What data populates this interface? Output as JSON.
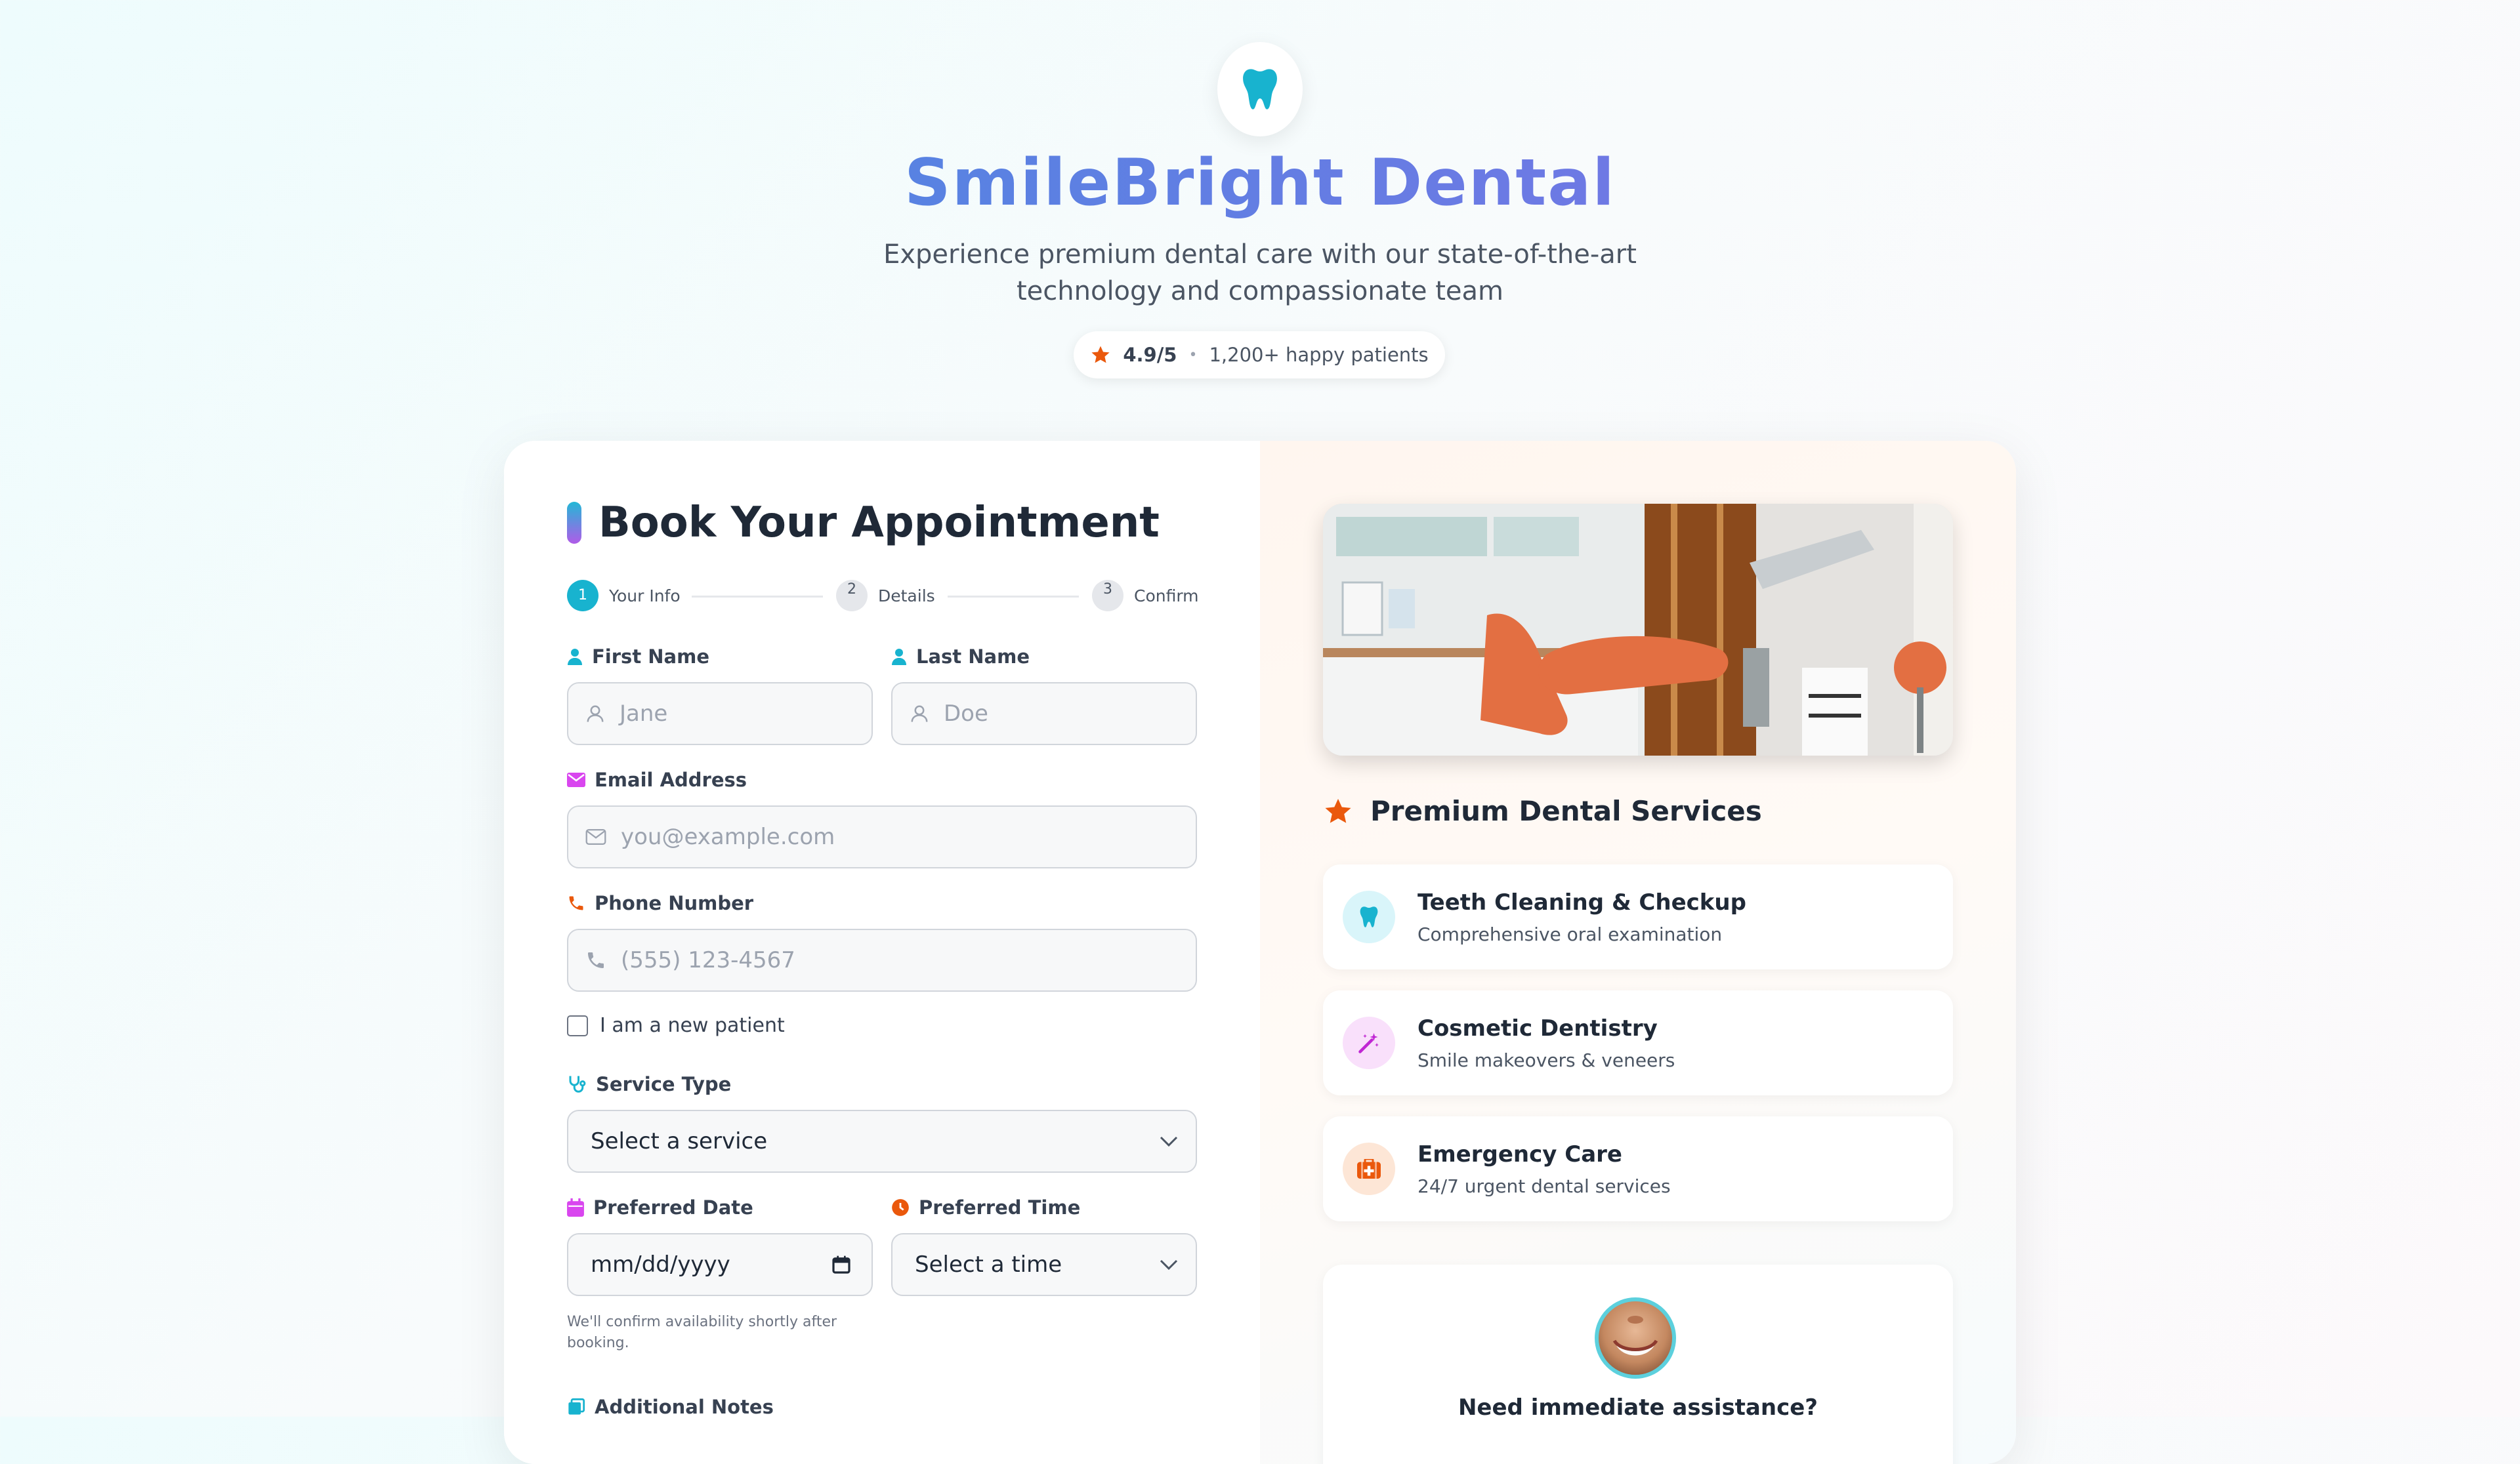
{
  "brand": {
    "name": "SmileBright Dental",
    "tagline": "Experience premium dental care with our state-of-the-art technology and compassionate team",
    "rating": "4.9/5",
    "rating_sep": "•",
    "patients": "1,200+ happy patients",
    "logo_icon": "tooth-icon",
    "accent": "#18b3cf"
  },
  "form": {
    "title": "Book Your Appointment",
    "steps": [
      {
        "num": "1",
        "label": "Your Info"
      },
      {
        "num": "2",
        "label": "Details"
      },
      {
        "num": "3",
        "label": "Confirm"
      }
    ],
    "first_name": {
      "label": "First Name",
      "placeholder": "Jane"
    },
    "last_name": {
      "label": "Last Name",
      "placeholder": "Doe"
    },
    "email": {
      "label": "Email Address",
      "placeholder": "you@example.com"
    },
    "phone": {
      "label": "Phone Number",
      "placeholder": "(555) 123-4567"
    },
    "new_patient": "I am a new patient",
    "service": {
      "label": "Service Type",
      "value": "Select a service"
    },
    "date": {
      "label": "Preferred Date",
      "value": "mm/dd/yyyy"
    },
    "time": {
      "label": "Preferred Time",
      "value": "Select a time"
    },
    "hint": "We'll confirm availability shortly after booking.",
    "notes": {
      "label": "Additional Notes"
    }
  },
  "services": {
    "title": "Premium Dental Services",
    "items": [
      {
        "name": "Teeth Cleaning & Checkup",
        "desc": "Comprehensive oral examination",
        "icon": "tooth-icon",
        "color": "#18b3cf"
      },
      {
        "name": "Cosmetic Dentistry",
        "desc": "Smile makeovers & veneers",
        "icon": "magic-wand-icon",
        "color": "#c026d3"
      },
      {
        "name": "Emergency Care",
        "desc": "24/7 urgent dental services",
        "icon": "first-aid-kit-icon",
        "color": "#ea580c"
      }
    ]
  },
  "help": {
    "title": "Need immediate assistance?"
  }
}
